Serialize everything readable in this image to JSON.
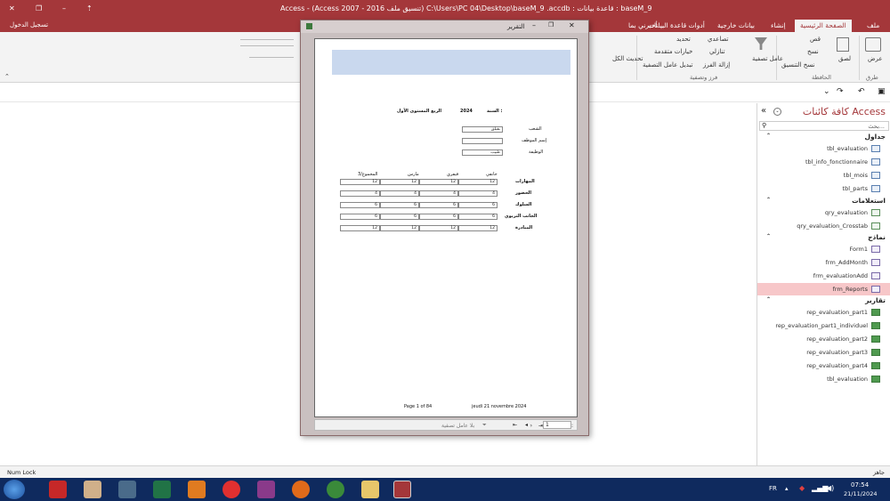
{
  "title_bar": {
    "title": "Access - (Access 2007 - 2016 تنسيق ملف) C:\\Users\\PC 04\\Desktop\\baseM_9 .accdb : قاعدة بيانات :  baseM_9",
    "sign_in": "تسجيل الدخول",
    "tell_me": "أخبرني بما..."
  },
  "ribbon_tabs": [
    "ملف",
    "الصفحة الرئيسية",
    "إنشاء",
    "بيانات خارجية",
    "أدوات قاعدة البيانات"
  ],
  "ribbon": {
    "view_label": "عرض",
    "views_group": "طرق عرض",
    "paste": "لصق",
    "cut": "قص",
    "copy": "نسخ",
    "format_painter": "نسخ التنسيق",
    "clipboard_group": "الحافظة",
    "filter": "عامل تصفية",
    "ascending": "تصاعدي",
    "descending": "تنازلي",
    "remove_sort": "إزالة الفرز",
    "selection": "تحديد",
    "advanced": "خيارات متقدمة",
    "toggle_filter": "تبديل عامل التصفية",
    "sort_filter_group": "فرز وتصفية",
    "refresh_all": "تحديث الكل"
  },
  "nav_pane": {
    "title": "كافة كائنات Access",
    "search_placeholder": "بحث...",
    "groups": [
      {
        "name": "جداول",
        "items": [
          "tbl_evaluation",
          "tbl_info_fonctionnaire",
          "tbl_mois",
          "tbl_parts"
        ]
      },
      {
        "name": "استعلامات",
        "items": [
          "qry_evaluation",
          "qry_evaluation_Crosstab"
        ]
      },
      {
        "name": "نماذج",
        "items": [
          "Form1",
          "frm_AddMonth",
          "frm_evaluationAdd",
          "frm_Reports"
        ]
      },
      {
        "name": "تقارير",
        "items": [
          "rep_evaluation_part1",
          "rep_evaluation_part1_individuel",
          "rep_evaluation_part2",
          "rep_evaluation_part3",
          "rep_evaluation_part4",
          "tbl_evaluation"
        ]
      }
    ],
    "selected_item": "frm_Reports"
  },
  "report_window": {
    "title": "التقرير",
    "year_label": "السنة :",
    "year_value": "2024",
    "quarter": "الربع المستوى الأول",
    "fields": [
      {
        "label": "الشعب",
        "value": "بفيلق"
      },
      {
        "label": "إسم الموظف",
        "value": ""
      },
      {
        "label": "الوظيفة",
        "value": "طبيب"
      }
    ],
    "table_headers": [
      "جانفي",
      "فيفري",
      "مارس",
      "المجموع/3"
    ],
    "rows": [
      {
        "label": "المهارات",
        "values": [
          "12",
          "12",
          "12",
          "12"
        ]
      },
      {
        "label": "الحضور",
        "values": [
          "4",
          "4",
          "4",
          "4"
        ]
      },
      {
        "label": "السلوك",
        "values": [
          "6",
          "6",
          "6",
          "6"
        ]
      },
      {
        "label": "الجانب التربوي",
        "values": [
          "6",
          "6",
          "6",
          "6"
        ]
      },
      {
        "label": "المبادرة",
        "values": [
          "12",
          "12",
          "12",
          "12"
        ]
      }
    ],
    "footer_page": "Page 1 of 84",
    "footer_date": "jeudi 21 novembre 2024",
    "pager_label": "صفحة:",
    "pager_value": "1",
    "no_filter": "بلا عامل تصفية"
  },
  "status_bar": {
    "num_lock": "Num Lock",
    "ready": "جاهز"
  },
  "taskbar": {
    "lang": "FR",
    "time": "07:54",
    "date": "21/11/2024"
  }
}
